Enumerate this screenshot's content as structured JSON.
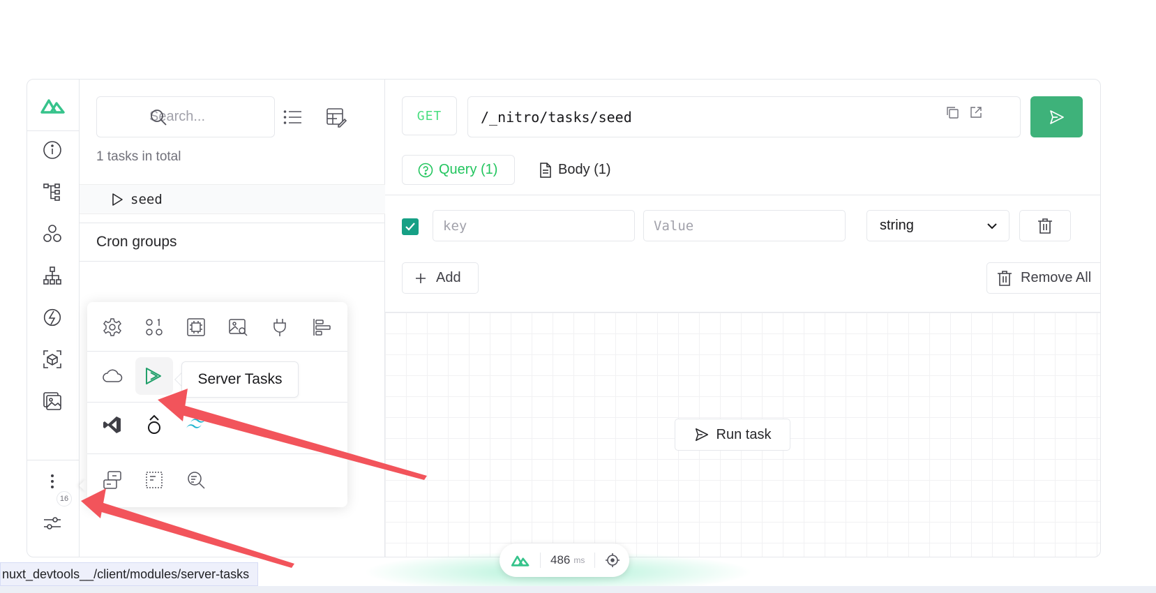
{
  "nav": {
    "items": [
      {
        "icon": "nuxt-logo-icon"
      },
      {
        "icon": "info-icon"
      },
      {
        "icon": "components-tree-icon"
      },
      {
        "icon": "composables-icon"
      },
      {
        "icon": "pages-tree-icon"
      },
      {
        "icon": "vite-icon"
      },
      {
        "icon": "inspect-cube-icon"
      },
      {
        "icon": "assets-image-icon"
      },
      {
        "icon": "more-vertical-icon"
      },
      {
        "icon": "settings-sliders-icon"
      }
    ],
    "more_badge": "16"
  },
  "list": {
    "search_placeholder": "Search...",
    "count_text": "1 tasks in total",
    "tasks": [
      {
        "label": "seed"
      }
    ],
    "cron_heading": "Cron groups"
  },
  "request": {
    "method": "GET",
    "url": "/_nitro/tasks/seed",
    "tabs": [
      {
        "label": "Query (1)",
        "active": true
      },
      {
        "label": "Body (1)",
        "active": false
      }
    ],
    "param_row": {
      "checked": true,
      "key_placeholder": "key",
      "value_placeholder": "Value",
      "type": "string"
    },
    "add_label": "Add",
    "remove_all_label": "Remove All",
    "run_label": "Run task"
  },
  "popover": {
    "rows": [
      [
        "runtime-config-icon",
        "payload-icon",
        "render-tree-icon",
        "images-icon",
        "hooks-plug-icon",
        "timeline-icon"
      ],
      [
        "cloud-icon",
        "server-tasks-icon"
      ],
      [
        "vscode-icon",
        "open-graph-icon",
        "tailwind-icon"
      ],
      [
        "server-discovery-icon",
        "virtual-files-icon",
        "search-inspect-icon"
      ]
    ]
  },
  "tooltip": {
    "text": "Server Tasks"
  },
  "floatbar": {
    "ms_value": "486",
    "ms_unit": "ms"
  },
  "status_url": "nuxt_devtools__/client/modules/server-tasks",
  "colors": {
    "accent": "#3eb27a",
    "accent_text": "#22c55e",
    "arrow": "#f2545b"
  }
}
